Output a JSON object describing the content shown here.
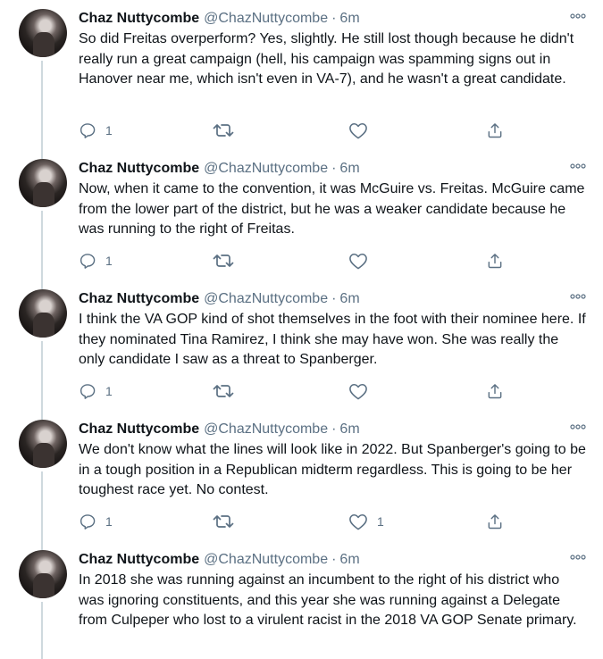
{
  "tweets": [
    {
      "name": "Chaz Nuttycombe",
      "handle": "@ChazNuttycombe",
      "separator": "·",
      "time": "6m",
      "text": "So did Freitas overperform? Yes, slightly. He still lost though because he didn't really run a great campaign (hell, his campaign was spamming signs out in Hanover near me, which isn't even in VA-7), and he wasn't a great candidate.",
      "reply_count": "1",
      "like_count": ""
    },
    {
      "name": "Chaz Nuttycombe",
      "handle": "@ChazNuttycombe",
      "separator": "·",
      "time": "6m",
      "text": "Now, when it came to the convention, it was McGuire vs. Freitas. McGuire came from the lower part of the district, but he was a weaker candidate because he was running to the right of Freitas.",
      "reply_count": "1",
      "like_count": ""
    },
    {
      "name": "Chaz Nuttycombe",
      "handle": "@ChazNuttycombe",
      "separator": "·",
      "time": "6m",
      "text": "I think the VA GOP kind of shot themselves in the foot with their nominee here. If they nominated Tina Ramirez, I think she may have won. She was really the only candidate I saw as a threat to Spanberger.",
      "reply_count": "1",
      "like_count": ""
    },
    {
      "name": "Chaz Nuttycombe",
      "handle": "@ChazNuttycombe",
      "separator": "·",
      "time": "6m",
      "text": "We don't know what the lines will look like in 2022. But Spanberger's going to be in a tough position in a Republican midterm regardless. This is going to be her toughest race yet. No contest.",
      "reply_count": "1",
      "like_count": "1"
    },
    {
      "name": "Chaz Nuttycombe",
      "handle": "@ChazNuttycombe",
      "separator": "·",
      "time": "6m",
      "text": "In 2018 she was running against an incumbent to the right of his district who was ignoring constituents, and this year she was running against a Delegate from Culpeper who lost to a virulent racist in the 2018 VA GOP Senate primary.",
      "reply_count": "",
      "like_count": ""
    }
  ],
  "colors": {
    "muted": "#5b7083",
    "thread_line": "#cfd9de",
    "text": "#0f1419"
  },
  "icons": [
    "reply-icon",
    "retweet-icon",
    "like-icon",
    "share-icon",
    "more-icon"
  ]
}
